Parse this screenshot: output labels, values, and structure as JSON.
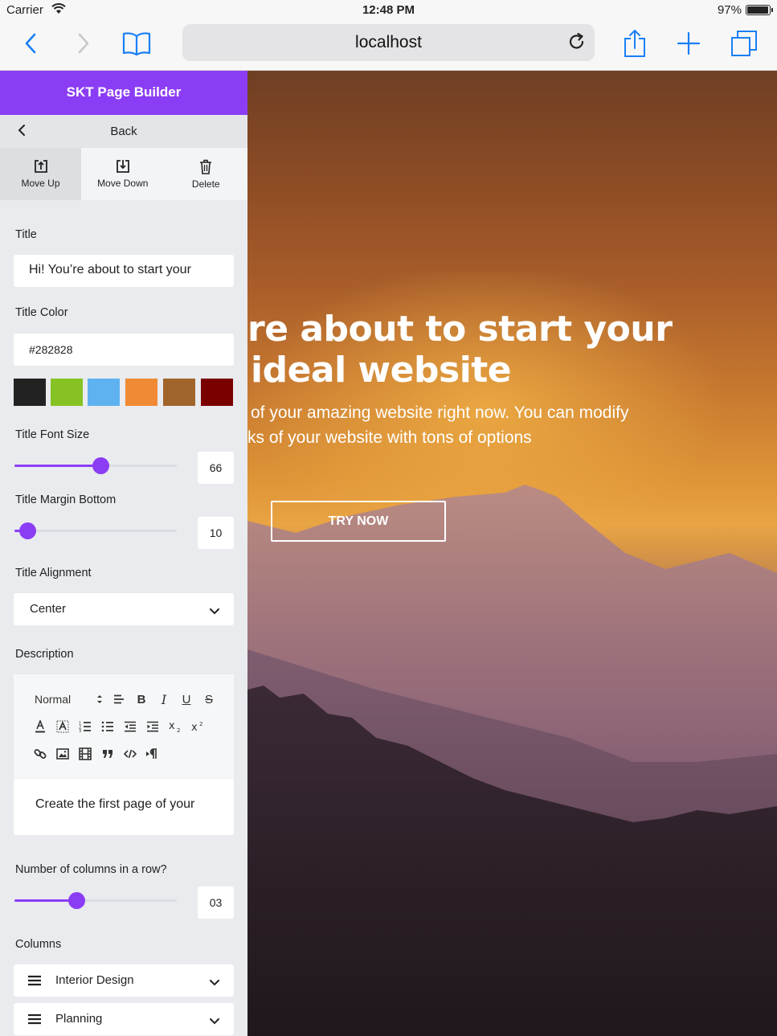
{
  "status_bar": {
    "carrier": "Carrier",
    "time": "12:48 PM",
    "battery": "97%"
  },
  "browser": {
    "url": "localhost"
  },
  "panel": {
    "header_title": "SKT Page Builder",
    "back_label": "Back",
    "actions": [
      {
        "label": "Move Up"
      },
      {
        "label": "Move Down"
      },
      {
        "label": "Delete"
      }
    ],
    "title": {
      "label": "Title",
      "value": "Hi! You’re about to start your"
    },
    "title_color": {
      "label": "Title Color",
      "value": "#282828",
      "swatches": [
        "#222222",
        "#86c223",
        "#5fb2f0",
        "#f08a35",
        "#a0652b",
        "#7a0000"
      ]
    },
    "title_font_size": {
      "label": "Title Font Size",
      "value": "66",
      "fraction": 0.53
    },
    "title_margin_bottom": {
      "label": "Title Margin Bottom",
      "value": "10",
      "fraction": 0.08
    },
    "title_alignment": {
      "label": "Title Alignment",
      "selected": "Center"
    },
    "description": {
      "label": "Description",
      "format_selected": "Normal",
      "content": "Create the  first page of your"
    },
    "columns_per_row": {
      "label": "Number of columns in a row?",
      "value": "03",
      "fraction": 0.38
    },
    "columns": {
      "label": "Columns",
      "items": [
        {
          "label": "Interior Design"
        },
        {
          "label": "Planning"
        }
      ]
    }
  },
  "hero": {
    "title_line1": "re about to start your",
    "title_line2": "ideal website",
    "desc_line1": "of your amazing website right now. You can modify",
    "desc_line2": "ks of your website with tons of options",
    "button": "TRY NOW"
  },
  "colors": {
    "accent": "#8b3df5",
    "ios_blue": "#1a7ff5"
  }
}
